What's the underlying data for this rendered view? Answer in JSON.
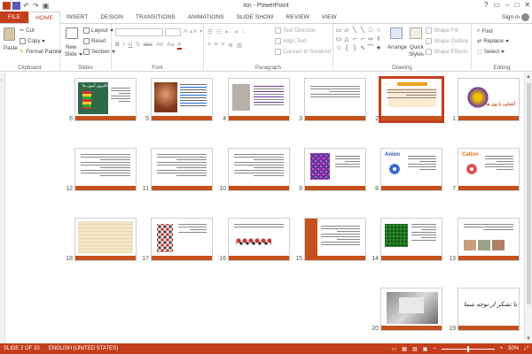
{
  "window": {
    "title": "ion - PowerPoint",
    "signin": "Sign in"
  },
  "tabs": [
    "FILE",
    "HOME",
    "INSERT",
    "DESIGN",
    "TRANSITIONS",
    "ANIMATIONS",
    "SLIDE SHOW",
    "REVIEW",
    "VIEW"
  ],
  "active_tab": "HOME",
  "ribbon": {
    "clipboard": {
      "label": "Clipboard",
      "paste": "Paste",
      "cut": "Cut",
      "copy": "Copy",
      "format_painter": "Format Painter"
    },
    "slides": {
      "label": "Slides",
      "new_slide": "New",
      "new_slide2": "Slide",
      "layout": "Layout",
      "reset": "Reset",
      "section": "Section"
    },
    "font": {
      "label": "Font",
      "format_buttons": [
        "B",
        "I",
        "U",
        "S",
        "abc",
        "AV",
        "Aa",
        "A"
      ]
    },
    "paragraph": {
      "label": "Paragraph",
      "text_direction": "Text Direction",
      "align_text": "Align Text",
      "convert_smartart": "Convert to SmartArt"
    },
    "drawing": {
      "label": "Drawing",
      "arrange": "Arrange",
      "quick_styles": "Quick",
      "quick_styles2": "Styles",
      "shape_fill": "Shape Fill",
      "shape_outline": "Shape Outline",
      "shape_effects": "Shape Effects",
      "shapes": [
        "▭",
        "▱",
        "╲",
        "╲",
        "□",
        "○",
        "▭",
        "△",
        "⌐",
        "⌐",
        "⇨",
        "⇩",
        "☆",
        "{",
        "}",
        "∿",
        "⌒",
        "★"
      ]
    },
    "editing": {
      "label": "Editing",
      "find": "Find",
      "replace": "Replace",
      "select": "Select"
    }
  },
  "slides": [
    {
      "num": "1",
      "title": "آشنایی با یون ها"
    },
    {
      "num": "2",
      "title": ""
    },
    {
      "num": "3",
      "title": ""
    },
    {
      "num": "4",
      "title": ""
    },
    {
      "num": "5",
      "title": ""
    },
    {
      "num": "6",
      "title": "الکترون آبیون ها"
    },
    {
      "num": "7",
      "title": "Cation"
    },
    {
      "num": "8",
      "title": "Anion"
    },
    {
      "num": "9",
      "title": ""
    },
    {
      "num": "10",
      "title": ""
    },
    {
      "num": "11",
      "title": ""
    },
    {
      "num": "12",
      "title": ""
    },
    {
      "num": "13",
      "title": ""
    },
    {
      "num": "14",
      "title": ""
    },
    {
      "num": "15",
      "title": ""
    },
    {
      "num": "16",
      "title": ""
    },
    {
      "num": "17",
      "title": ""
    },
    {
      "num": "18",
      "title": ""
    },
    {
      "num": "19",
      "title": "با تشکر از توجه شما"
    },
    {
      "num": "20",
      "title": ""
    }
  ],
  "selected_slide": "2",
  "status": {
    "slide": "SLIDE 2 OF 20",
    "language": "ENGLISH (UNITED STATES)",
    "zoom": "50%",
    "zoom_fraction": 0.5
  },
  "colors": {
    "accent": "#c43e1c",
    "slide_bar": "#c4521c"
  }
}
